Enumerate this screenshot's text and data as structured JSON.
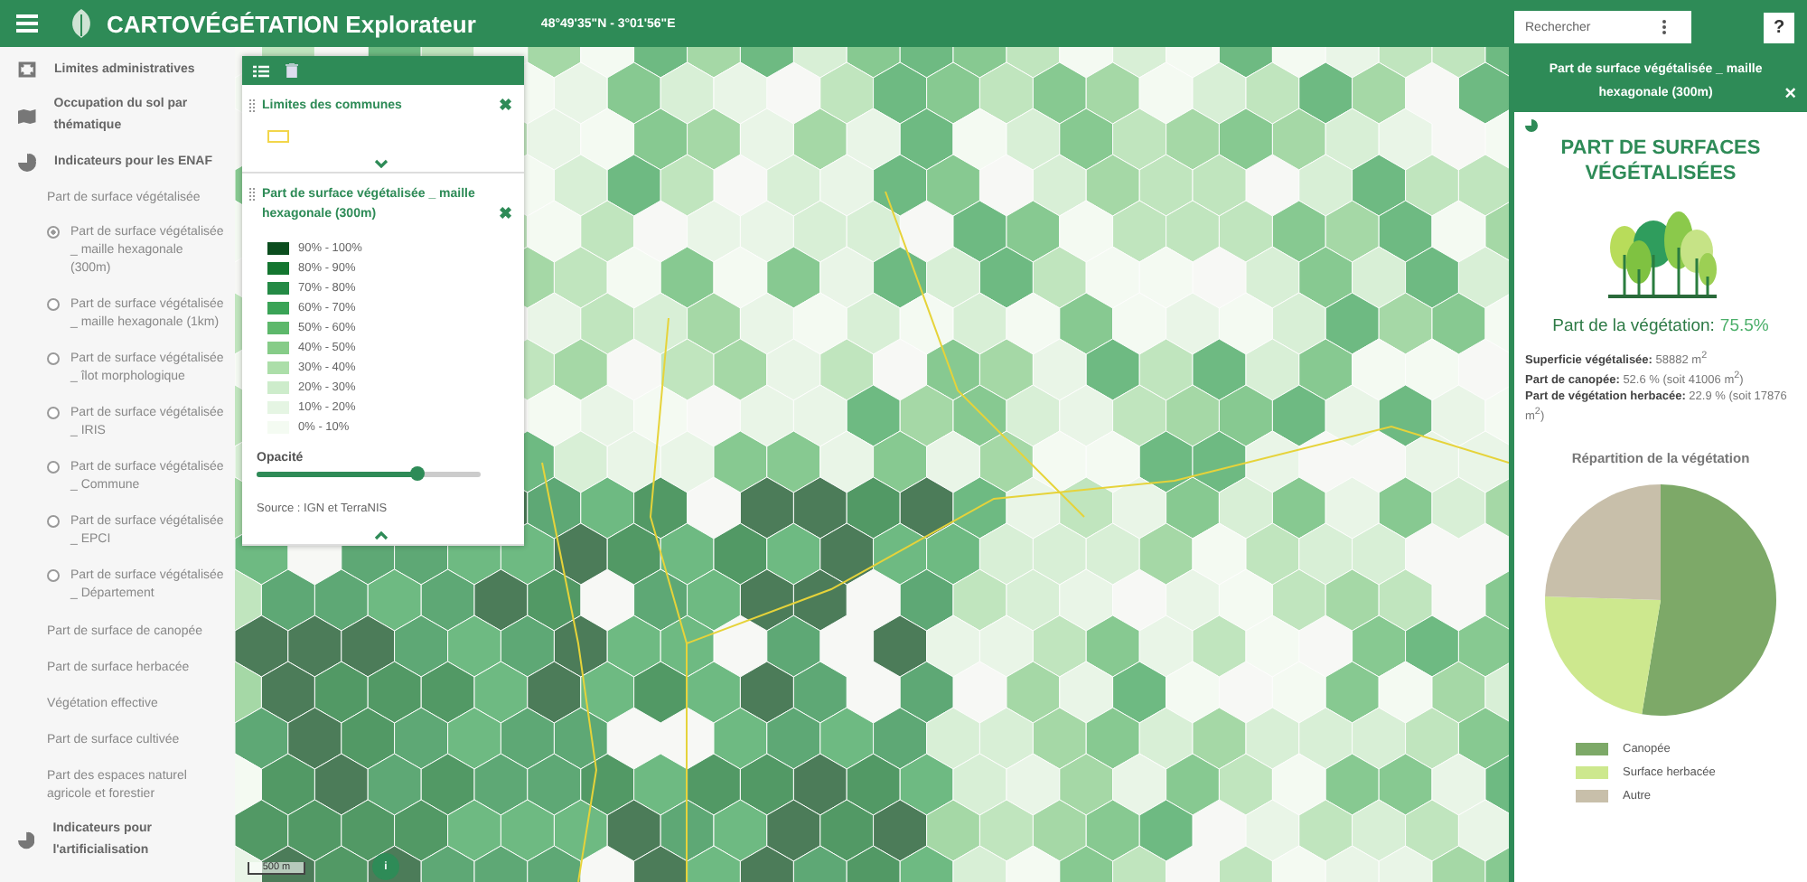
{
  "header": {
    "title": "CARTOVÉGÉTATION Explorateur",
    "coordinates": "48°49'35\"N - 3°01'56\"E",
    "search": {
      "placeholder": "Rechercher"
    },
    "help": "?"
  },
  "sidebar": {
    "items": [
      {
        "kind": "group",
        "label": "Limites administratives"
      },
      {
        "kind": "group",
        "label": "Occupation du sol par thématique"
      },
      {
        "kind": "group",
        "label": "Indicateurs pour les ENAF",
        "children": [
          {
            "kind": "sub",
            "label": "Part de surface végétalisée",
            "children": [
              {
                "kind": "radio",
                "label": "Part de surface végétalisée _ maille hexagonale (300m)",
                "selected": true
              },
              {
                "kind": "radio",
                "label": "Part de surface végétalisée _ maille hexagonale (1km)",
                "selected": false
              },
              {
                "kind": "radio",
                "label": "Part de surface végétalisée _ îlot morphologique",
                "selected": false
              },
              {
                "kind": "radio",
                "label": "Part de surface végétalisée _ IRIS",
                "selected": false
              },
              {
                "kind": "radio",
                "label": "Part de surface végétalisée _ Commune",
                "selected": false
              },
              {
                "kind": "radio",
                "label": "Part de surface végétalisée _ EPCI",
                "selected": false
              },
              {
                "kind": "radio",
                "label": "Part de surface végétalisée _ Département",
                "selected": false
              }
            ]
          },
          {
            "kind": "sub",
            "label": "Part de surface de canopée"
          },
          {
            "kind": "sub",
            "label": "Part de surface herbacée"
          },
          {
            "kind": "sub",
            "label": "Végétation effective"
          },
          {
            "kind": "sub",
            "label": "Part de surface cultivée"
          },
          {
            "kind": "sub",
            "label": "Part des espaces naturel agricole et forestier"
          }
        ]
      },
      {
        "kind": "group",
        "label": "Indicateurs pour l'artificialisation"
      }
    ]
  },
  "layers": [
    {
      "title": "Limites des communes",
      "remove": "✖",
      "expanded": false,
      "kind": "outline",
      "color": "#f2d64b"
    },
    {
      "title": "Part de surface végétalisée _ maille hexagonale (300m)",
      "remove": "✖",
      "expanded": true,
      "kind": "classes",
      "classes": [
        {
          "label": "90% - 100%",
          "color": "#0b4d1e"
        },
        {
          "label": "80% - 90%",
          "color": "#13752f"
        },
        {
          "label": "70% - 80%",
          "color": "#248a45"
        },
        {
          "label": "60% - 70%",
          "color": "#3aa356"
        },
        {
          "label": "50% - 60%",
          "color": "#5db86b"
        },
        {
          "label": "40% - 50%",
          "color": "#86cc88"
        },
        {
          "label": "30% - 40%",
          "color": "#acdea9"
        },
        {
          "label": "20% - 30%",
          "color": "#cdeccb"
        },
        {
          "label": "10% - 20%",
          "color": "#e5f5e3"
        },
        {
          "label": "0% - 10%",
          "color": "#f4fbf2"
        }
      ],
      "opacity": {
        "label": "Opacité",
        "level": 0.72
      },
      "source": "Source : IGN et TerraNIS"
    }
  ],
  "map": {
    "scale": "500 m",
    "info": "i"
  },
  "panel": {
    "header": "Part de surface végétalisée _ maille hexagonale (300m)",
    "close": "×",
    "title": "PART DE SURFACES VÉGÉTALISÉES",
    "share_label": "Part de la végétation:",
    "share_value": "75.5%",
    "stats": [
      "**Superficie végétalisée:** 58882 m$^{2}$",
      "**Part de canopée:** 52.6 % (soit 41006 m$^{2}$)",
      "**Part de végétation herbacée:** 22.9 % (soit 17876 m$^{2}$)"
    ],
    "chart_title": "Répartition de la végétation",
    "chart_data": {
      "type": "pie",
      "categories": [
        "Canopée",
        "Surface herbacée",
        "Autre"
      ],
      "values": [
        52.6,
        22.9,
        24.5
      ],
      "colors": [
        "#7da968",
        "#cde88e",
        "#c8bfaa"
      ]
    }
  }
}
